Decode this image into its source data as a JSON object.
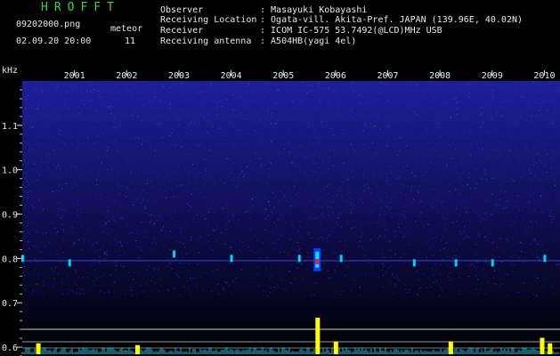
{
  "header": {
    "app_title": "HROFFT",
    "filename": "09202000.png",
    "timestamp": "02.09.20 20:00",
    "meteor_label": "meteor",
    "meteor_count": "11",
    "info": [
      {
        "label": "Observer",
        "value": ": Masayuki Kobayashi"
      },
      {
        "label": "Receiving Location",
        "value": ": Ogata-vill. Akita-Pref. JAPAN (139.96E, 40.02N)"
      },
      {
        "label": "Receiver",
        "value": ": ICOM IC-575 53.7492(@LCD)MHz USB"
      },
      {
        "label": "Receiving antenna",
        "value": ": A504HB(yagi 4el)"
      }
    ]
  },
  "axis": {
    "unit": "kHz",
    "y_ticks": [
      "1.1",
      "1.0",
      "0.9",
      "0.8",
      "0.7",
      "0.6"
    ],
    "x_ticks": [
      "2001",
      "2002",
      "2003",
      "2004",
      "2005",
      "2006",
      "2007",
      "2008",
      "2009",
      "2010"
    ]
  },
  "colors": {
    "background": "#000000",
    "noise_top": "#1a1a8c",
    "header_text": "#e8e8e8",
    "title_green": "#39d639",
    "meteor_line": "#00d0ff",
    "peak_yellow": "#ffff00",
    "peak_red": "#ff2020"
  },
  "chart_data": {
    "type": "heatmap",
    "x_unit": "minute of the hour (20:00–20:10)",
    "xlim": [
      2000,
      2010.3
    ],
    "ylim": [
      0.58,
      1.2
    ],
    "y_label": "kHz",
    "meteor_echoes": [
      {
        "x": 2000.0,
        "y": 0.8
      },
      {
        "x": 2000.9,
        "y": 0.79
      },
      {
        "x": 2002.9,
        "y": 0.81
      },
      {
        "x": 2004.0,
        "y": 0.8
      },
      {
        "x": 2005.6,
        "y": 0.79
      },
      {
        "x": 2005.3,
        "y": 0.8
      },
      {
        "x": 2006.1,
        "y": 0.8
      },
      {
        "x": 2007.5,
        "y": 0.79
      },
      {
        "x": 2008.3,
        "y": 0.79
      },
      {
        "x": 2009.0,
        "y": 0.79
      },
      {
        "x": 2010.0,
        "y": 0.8
      }
    ],
    "level_peaks": [
      {
        "x": 2005.65,
        "height": 1.0
      },
      {
        "x": 2006.0,
        "height": 0.35
      },
      {
        "x": 2000.3,
        "height": 0.3
      },
      {
        "x": 2002.2,
        "height": 0.25
      },
      {
        "x": 2008.2,
        "height": 0.35
      },
      {
        "x": 2009.95,
        "height": 0.45
      },
      {
        "x": 2010.1,
        "height": 0.3
      }
    ]
  }
}
